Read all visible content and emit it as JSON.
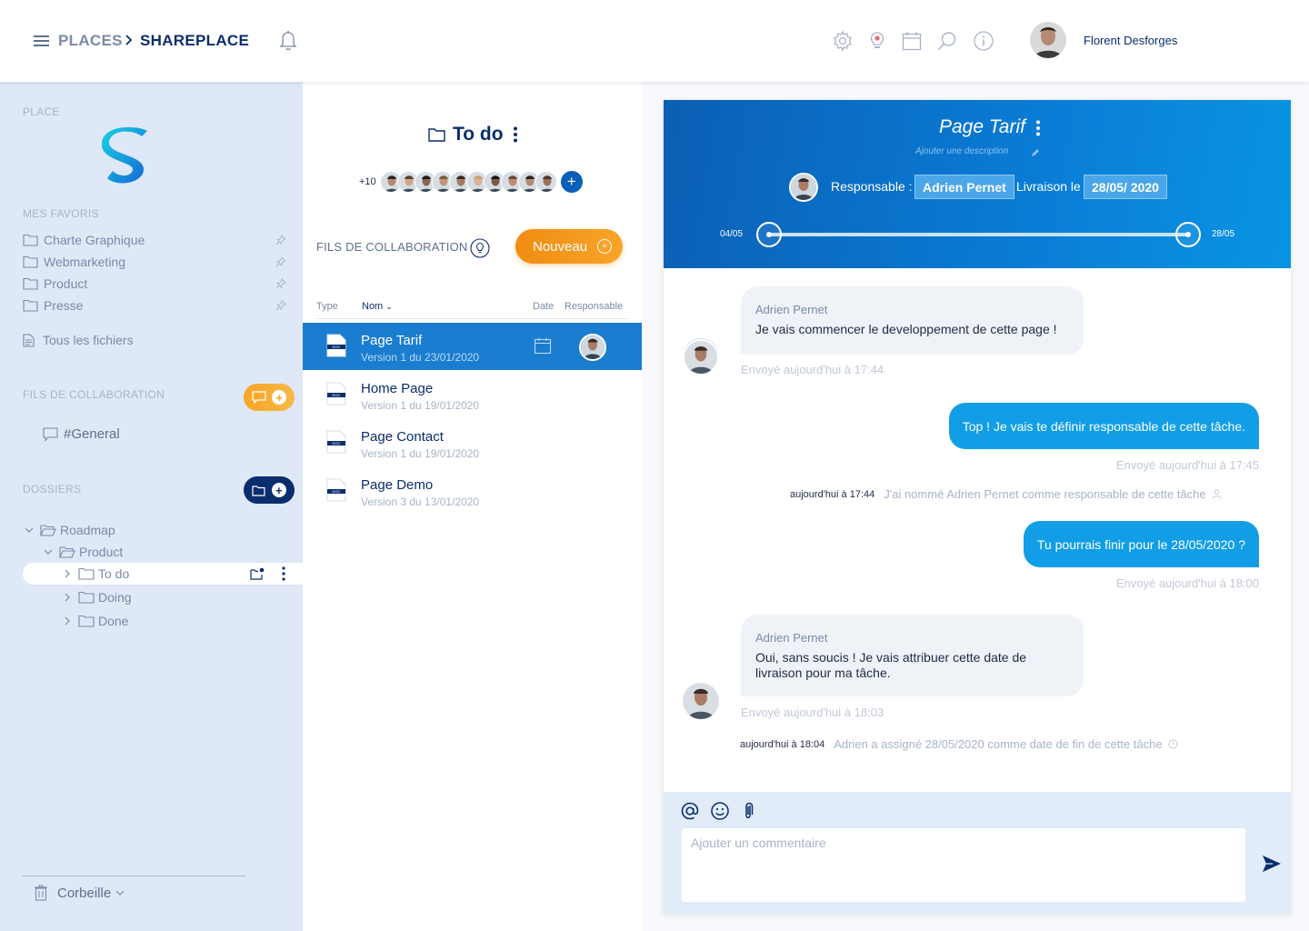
{
  "header": {
    "breadcrumb_root": "PLACES",
    "breadcrumb_current": "SHAREPLACE",
    "user_name": "Florent Desforges",
    "icons": [
      "menu-icon",
      "chevron-right-icon",
      "bell-icon",
      "gear-icon",
      "bulb-icon",
      "calendar-icon",
      "search-icon",
      "info-icon"
    ]
  },
  "sidebar": {
    "place_label": "PLACE",
    "logo_letter": "S",
    "favorites_label": "MES FAVORIS",
    "favorites": [
      {
        "label": "Charte Graphique"
      },
      {
        "label": "Webmarketing"
      },
      {
        "label": "Product"
      },
      {
        "label": "Presse"
      }
    ],
    "all_files": "Tous les fichiers",
    "collab_label": "FILS DE COLLABORATION",
    "channels": [
      {
        "label": "#General"
      }
    ],
    "folders_label": "DOSSIERS",
    "tree": [
      {
        "label": "Roadmap",
        "level": 0,
        "expanded": true
      },
      {
        "label": "Product",
        "level": 1,
        "expanded": true
      },
      {
        "label": "To do",
        "level": 2,
        "selected": true
      },
      {
        "label": "Doing",
        "level": 2
      },
      {
        "label": "Done",
        "level": 2
      }
    ],
    "trash": "Corbeille"
  },
  "middle": {
    "folder_title": "To do",
    "members_extra": "+10",
    "collab_label": "FILS DE COLLABORATION",
    "new_button": "Nouveau",
    "columns": {
      "type": "Type",
      "name": "Nom",
      "date": "Date",
      "responsible": "Responsable"
    },
    "files": [
      {
        "name": "Page Tarif",
        "version": "Version 1 du 23/01/2020",
        "active": true
      },
      {
        "name": "Home Page",
        "version": "Version 1 du 19/01/2020"
      },
      {
        "name": "Page Contact",
        "version": "Version 1 du 19/01/2020"
      },
      {
        "name": "Page Demo",
        "version": "Version 3 du 13/01/2020"
      }
    ],
    "doc_badge": "DOC"
  },
  "task": {
    "title": "Page Tarif",
    "description_placeholder": "Ajouter une description",
    "responsible_label": "Responsable :",
    "responsible_name": "Adrien Pernet",
    "delivery_label": "Livraison le",
    "delivery_date": "28/05/ 2020",
    "slider_start": "04/05",
    "slider_end": "28/05",
    "progress": 1.0,
    "colors": {
      "header_start": "#0b5fb4",
      "header_end": "#0994e3",
      "bubble_out": "#129ee6"
    }
  },
  "messages": [
    {
      "type": "in",
      "sender": "Adrien Pernet",
      "text": "Je vais commencer le developpement de cette page !",
      "meta": "Envoyé aujourd'hui à 17:44"
    },
    {
      "type": "out",
      "text": "Top ! Je vais te définir responsable de cette tâche.",
      "meta": "Envoyé aujourd'hui à 17:45"
    },
    {
      "type": "system",
      "time": "aujourd'hui à 17:44",
      "text": "J'ai nommé Adrien Pernet comme responsable de cette tâche"
    },
    {
      "type": "out",
      "text": "Tu pourrais finir pour le 28/05/2020 ?",
      "meta": "Envoyé aujourd'hui à 18:00"
    },
    {
      "type": "in",
      "sender": "Adrien Pernet",
      "text": "Oui, sans soucis ! Je vais attribuer cette date de livraison pour ma tâche.",
      "meta": "Envoyé aujourd'hui à 18:03"
    },
    {
      "type": "system",
      "time": "aujourd'hui à 18:04",
      "text": "Adrien a assigné 28/05/2020 comme date de fin de cette tâche"
    }
  ],
  "composer": {
    "placeholder": "Ajouter un commentaire",
    "icons": [
      "mention-icon",
      "emoji-icon",
      "attachment-icon",
      "send-icon"
    ]
  }
}
